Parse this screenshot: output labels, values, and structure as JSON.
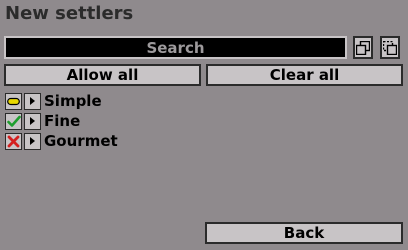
{
  "title": "New settlers",
  "search": {
    "label": "Search",
    "icons": [
      "copy-icon",
      "paste-icon"
    ]
  },
  "actions": {
    "allow_all": "Allow all",
    "clear_all": "Clear all"
  },
  "items": [
    {
      "label": "Simple",
      "state": "partial",
      "icon": "minus-pill-icon",
      "color": "#e8d800"
    },
    {
      "label": "Fine",
      "state": "allowed",
      "icon": "check-icon",
      "color": "#1e9e2e"
    },
    {
      "label": "Gourmet",
      "state": "disallowed",
      "icon": "cross-icon",
      "color": "#d41f1f"
    }
  ],
  "footer": {
    "back": "Back"
  }
}
